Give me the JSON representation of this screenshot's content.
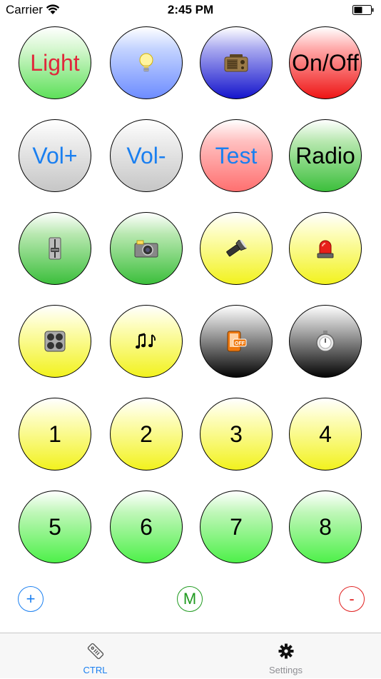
{
  "status_bar": {
    "carrier": "Carrier",
    "time": "2:45 PM"
  },
  "colors": {
    "accent": "#1a7ff0",
    "light_text": "#e0283c",
    "green_text": "#1f9a1f",
    "red_text": "#e02020",
    "tab_active": "#1a7ff0",
    "tab_inactive": "#8e8e93"
  },
  "grid": {
    "row1": {
      "b1": {
        "label": "Light",
        "color": "#e0283c"
      },
      "b2": {
        "icon": "light-bulb-icon"
      },
      "b3": {
        "icon": "radio-icon"
      },
      "b4": {
        "label": "On/Off",
        "color": "#000000"
      }
    },
    "row2": {
      "b1": {
        "label": "Vol+",
        "color": "#1a7ff0"
      },
      "b2": {
        "label": "Vol-",
        "color": "#1a7ff0"
      },
      "b3": {
        "label": "Test",
        "color": "#1a7ff0"
      },
      "b4": {
        "label": "Radio",
        "color": "#000000"
      }
    },
    "row3": {
      "b1": {
        "icon": "fader-icon"
      },
      "b2": {
        "icon": "camera-icon"
      },
      "b3": {
        "icon": "flashlight-icon"
      },
      "b4": {
        "icon": "siren-icon"
      }
    },
    "row4": {
      "b1": {
        "icon": "stove-icon"
      },
      "b2": {
        "icon": "music-notes-icon"
      },
      "b3": {
        "icon": "phone-off-icon"
      },
      "b4": {
        "icon": "timer-icon"
      }
    },
    "row5": {
      "b1": {
        "label": "1"
      },
      "b2": {
        "label": "2"
      },
      "b3": {
        "label": "3"
      },
      "b4": {
        "label": "4"
      }
    },
    "row6": {
      "b1": {
        "label": "5"
      },
      "b2": {
        "label": "6"
      },
      "b3": {
        "label": "7"
      },
      "b4": {
        "label": "8"
      }
    }
  },
  "controls": {
    "add_label": "+",
    "mode_label": "M",
    "remove_label": "-"
  },
  "tab_bar": {
    "ctrl_label": "CTRL",
    "settings_label": "Settings",
    "active": "CTRL"
  }
}
